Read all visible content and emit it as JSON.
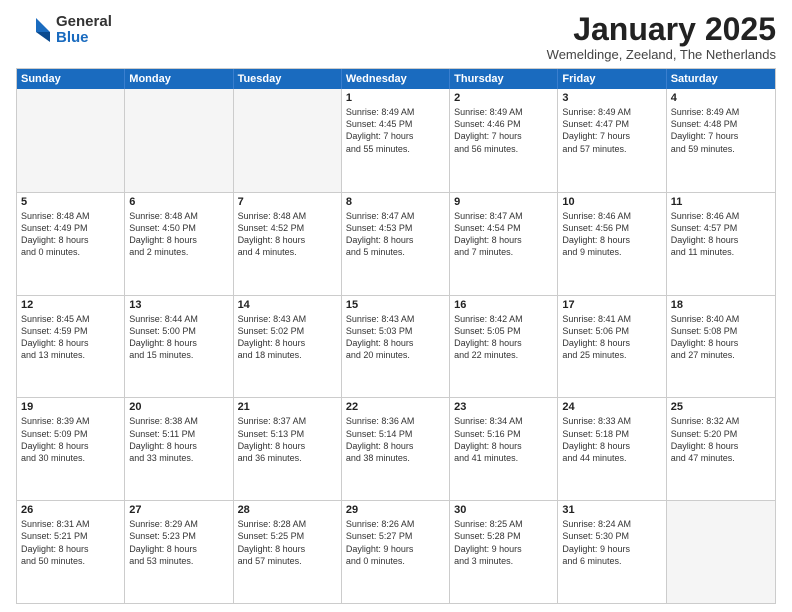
{
  "logo": {
    "general": "General",
    "blue": "Blue"
  },
  "title": "January 2025",
  "subtitle": "Wemeldinge, Zeeland, The Netherlands",
  "header_days": [
    "Sunday",
    "Monday",
    "Tuesday",
    "Wednesday",
    "Thursday",
    "Friday",
    "Saturday"
  ],
  "weeks": [
    [
      {
        "day": "",
        "text": ""
      },
      {
        "day": "",
        "text": ""
      },
      {
        "day": "",
        "text": ""
      },
      {
        "day": "1",
        "text": "Sunrise: 8:49 AM\nSunset: 4:45 PM\nDaylight: 7 hours\nand 55 minutes."
      },
      {
        "day": "2",
        "text": "Sunrise: 8:49 AM\nSunset: 4:46 PM\nDaylight: 7 hours\nand 56 minutes."
      },
      {
        "day": "3",
        "text": "Sunrise: 8:49 AM\nSunset: 4:47 PM\nDaylight: 7 hours\nand 57 minutes."
      },
      {
        "day": "4",
        "text": "Sunrise: 8:49 AM\nSunset: 4:48 PM\nDaylight: 7 hours\nand 59 minutes."
      }
    ],
    [
      {
        "day": "5",
        "text": "Sunrise: 8:48 AM\nSunset: 4:49 PM\nDaylight: 8 hours\nand 0 minutes."
      },
      {
        "day": "6",
        "text": "Sunrise: 8:48 AM\nSunset: 4:50 PM\nDaylight: 8 hours\nand 2 minutes."
      },
      {
        "day": "7",
        "text": "Sunrise: 8:48 AM\nSunset: 4:52 PM\nDaylight: 8 hours\nand 4 minutes."
      },
      {
        "day": "8",
        "text": "Sunrise: 8:47 AM\nSunset: 4:53 PM\nDaylight: 8 hours\nand 5 minutes."
      },
      {
        "day": "9",
        "text": "Sunrise: 8:47 AM\nSunset: 4:54 PM\nDaylight: 8 hours\nand 7 minutes."
      },
      {
        "day": "10",
        "text": "Sunrise: 8:46 AM\nSunset: 4:56 PM\nDaylight: 8 hours\nand 9 minutes."
      },
      {
        "day": "11",
        "text": "Sunrise: 8:46 AM\nSunset: 4:57 PM\nDaylight: 8 hours\nand 11 minutes."
      }
    ],
    [
      {
        "day": "12",
        "text": "Sunrise: 8:45 AM\nSunset: 4:59 PM\nDaylight: 8 hours\nand 13 minutes."
      },
      {
        "day": "13",
        "text": "Sunrise: 8:44 AM\nSunset: 5:00 PM\nDaylight: 8 hours\nand 15 minutes."
      },
      {
        "day": "14",
        "text": "Sunrise: 8:43 AM\nSunset: 5:02 PM\nDaylight: 8 hours\nand 18 minutes."
      },
      {
        "day": "15",
        "text": "Sunrise: 8:43 AM\nSunset: 5:03 PM\nDaylight: 8 hours\nand 20 minutes."
      },
      {
        "day": "16",
        "text": "Sunrise: 8:42 AM\nSunset: 5:05 PM\nDaylight: 8 hours\nand 22 minutes."
      },
      {
        "day": "17",
        "text": "Sunrise: 8:41 AM\nSunset: 5:06 PM\nDaylight: 8 hours\nand 25 minutes."
      },
      {
        "day": "18",
        "text": "Sunrise: 8:40 AM\nSunset: 5:08 PM\nDaylight: 8 hours\nand 27 minutes."
      }
    ],
    [
      {
        "day": "19",
        "text": "Sunrise: 8:39 AM\nSunset: 5:09 PM\nDaylight: 8 hours\nand 30 minutes."
      },
      {
        "day": "20",
        "text": "Sunrise: 8:38 AM\nSunset: 5:11 PM\nDaylight: 8 hours\nand 33 minutes."
      },
      {
        "day": "21",
        "text": "Sunrise: 8:37 AM\nSunset: 5:13 PM\nDaylight: 8 hours\nand 36 minutes."
      },
      {
        "day": "22",
        "text": "Sunrise: 8:36 AM\nSunset: 5:14 PM\nDaylight: 8 hours\nand 38 minutes."
      },
      {
        "day": "23",
        "text": "Sunrise: 8:34 AM\nSunset: 5:16 PM\nDaylight: 8 hours\nand 41 minutes."
      },
      {
        "day": "24",
        "text": "Sunrise: 8:33 AM\nSunset: 5:18 PM\nDaylight: 8 hours\nand 44 minutes."
      },
      {
        "day": "25",
        "text": "Sunrise: 8:32 AM\nSunset: 5:20 PM\nDaylight: 8 hours\nand 47 minutes."
      }
    ],
    [
      {
        "day": "26",
        "text": "Sunrise: 8:31 AM\nSunset: 5:21 PM\nDaylight: 8 hours\nand 50 minutes."
      },
      {
        "day": "27",
        "text": "Sunrise: 8:29 AM\nSunset: 5:23 PM\nDaylight: 8 hours\nand 53 minutes."
      },
      {
        "day": "28",
        "text": "Sunrise: 8:28 AM\nSunset: 5:25 PM\nDaylight: 8 hours\nand 57 minutes."
      },
      {
        "day": "29",
        "text": "Sunrise: 8:26 AM\nSunset: 5:27 PM\nDaylight: 9 hours\nand 0 minutes."
      },
      {
        "day": "30",
        "text": "Sunrise: 8:25 AM\nSunset: 5:28 PM\nDaylight: 9 hours\nand 3 minutes."
      },
      {
        "day": "31",
        "text": "Sunrise: 8:24 AM\nSunset: 5:30 PM\nDaylight: 9 hours\nand 6 minutes."
      },
      {
        "day": "",
        "text": ""
      }
    ]
  ]
}
